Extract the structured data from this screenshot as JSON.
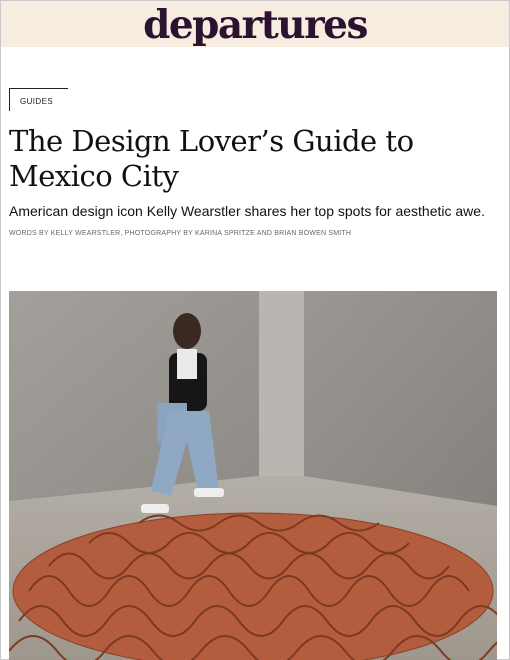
{
  "site": {
    "logo_text": "departures"
  },
  "article": {
    "category": "GUIDES",
    "headline_line1": "The Design Lover’s Guide to",
    "headline_line2": "Mexico City",
    "dek": "American design icon Kelly Wearstler shares her top spots for aesthetic awe.",
    "credits": "WORDS BY KELLY WEARSTLER, PHOTOGRAPHY BY KARINA SPRITZE AND BRIAN BOWEN SMITH"
  },
  "colors": {
    "masthead_bg": "#f7ece0",
    "logo": "#2b1330",
    "sculpture": "#c46a47",
    "wall": "#9a9792"
  }
}
